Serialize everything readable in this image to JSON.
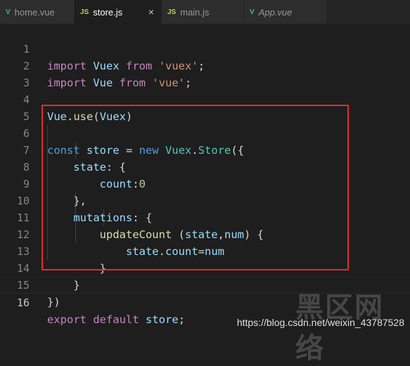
{
  "tabs": [
    {
      "label": "home.vue",
      "icon": "vue-file-icon",
      "active": false
    },
    {
      "label": "store.js",
      "icon": "js-file-icon",
      "active": true,
      "close": "×"
    },
    {
      "label": "main.js",
      "icon": "js-file-icon",
      "active": false
    },
    {
      "label": "App.vue",
      "icon": "vue-file-icon",
      "active": false
    }
  ],
  "tab_icon_js": "JS",
  "tab_icon_vue": "V",
  "line_numbers": [
    "1",
    "2",
    "3",
    "4",
    "5",
    "6",
    "7",
    "8",
    "9",
    "10",
    "11",
    "12",
    "13",
    "14",
    "15",
    "16"
  ],
  "current_line": "16",
  "code": {
    "l1": {
      "k1": "import",
      "v": "Vuex",
      "k2": "from",
      "s": "'vuex'",
      "p": ";"
    },
    "l2": {
      "k1": "import",
      "v": "Vue",
      "k2": "from",
      "s": "'vue'",
      "p": ";"
    },
    "l4": {
      "v": "Vue",
      "p1": ".",
      "fn": "use",
      "p2": "(",
      "a": "Vuex",
      "p3": ")"
    },
    "l6": {
      "k": "const",
      "v": "store",
      "eq": " = ",
      "n": "new",
      "c1": "Vuex",
      "d": ".",
      "c2": "Store",
      "p": "({"
    },
    "l7": {
      "v": "state",
      "p": ": {"
    },
    "l8": {
      "v": "count",
      "p": ":",
      "num": "0"
    },
    "l9": {
      "p": "},"
    },
    "l10": {
      "v": "mutations",
      "p": ": {"
    },
    "l11": {
      "fn": "updateCount",
      "p1": " (",
      "a1": "state",
      "c": ",",
      "a2": "num",
      "p2": ") {"
    },
    "l12": {
      "v1": "state",
      "d": ".",
      "v2": "count",
      "eq": "=",
      "v3": "num"
    },
    "l13": {
      "p": "}"
    },
    "l14": {
      "p": "}"
    },
    "l15": {
      "p": "})"
    },
    "l16": {
      "k1": "export",
      "k2": "default",
      "v": "store",
      "p": ";"
    }
  },
  "watermark": "https://blog.csdn.net/weixin_43787528",
  "logo_text": "黑区网络",
  "colors": {
    "highlight_box": "#e52b2b",
    "background": "#1e1e1e"
  }
}
